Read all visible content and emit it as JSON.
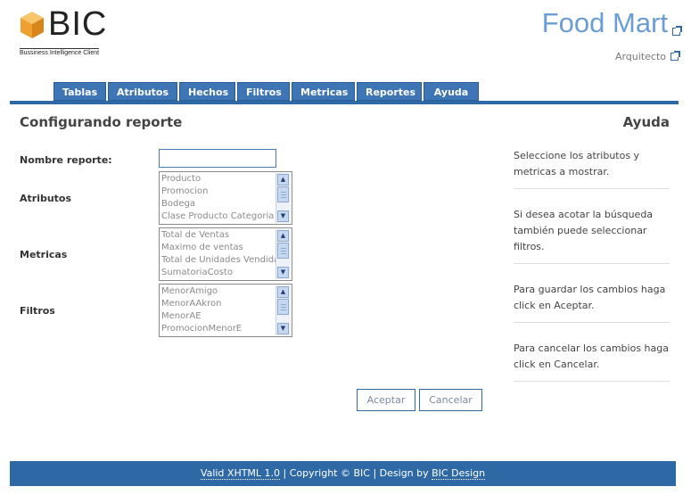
{
  "header": {
    "logo_text": "BIC",
    "logo_tagline": "Bussiness Intelligence Client",
    "site_title": "Food Mart",
    "user_link": "Arquitecto"
  },
  "nav": {
    "tabs": [
      "Tablas",
      "Atributos",
      "Hechos",
      "Filtros",
      "Metricas",
      "Reportes",
      "Ayuda"
    ]
  },
  "main": {
    "title": "Configurando reporte",
    "form": {
      "nombre_label": "Nombre reporte:",
      "nombre_value": "",
      "atributos_label": "Atributos",
      "atributos_options": [
        "Producto",
        "Promocion",
        "Bodega",
        "Clase Producto Categoria"
      ],
      "metricas_label": "Metricas",
      "metricas_options": [
        "Total de Ventas",
        "Maximo de ventas",
        "Total de Unidades Vendidas",
        "SumatoriaCosto"
      ],
      "filtros_label": "Filtros",
      "filtros_options": [
        "MenorAmigo",
        "MenorAAkron",
        "MenorAE",
        "PromocionMenorE"
      ],
      "aceptar_label": "Aceptar",
      "cancelar_label": "Cancelar"
    }
  },
  "help": {
    "title": "Ayuda",
    "items": [
      "Seleccione los atributos y metricas a mostrar.",
      "Si desea acotar la búsqueda también puede seleccionar filtros.",
      "Para guardar los cambios haga click en Aceptar.",
      "Para cancelar los cambios haga click en Cancelar."
    ]
  },
  "footer": {
    "xhtml": "Valid XHTML 1.0",
    "sep1": " | ",
    "copyright": "Copyright © BIC",
    "sep2": " | Design by ",
    "design": "BIC Design"
  },
  "colors": {
    "accent": "#2e69a6",
    "tab_bg": "#3e75b5",
    "title_blue": "#6a9dd4",
    "logo_orange": "#f0a030"
  }
}
